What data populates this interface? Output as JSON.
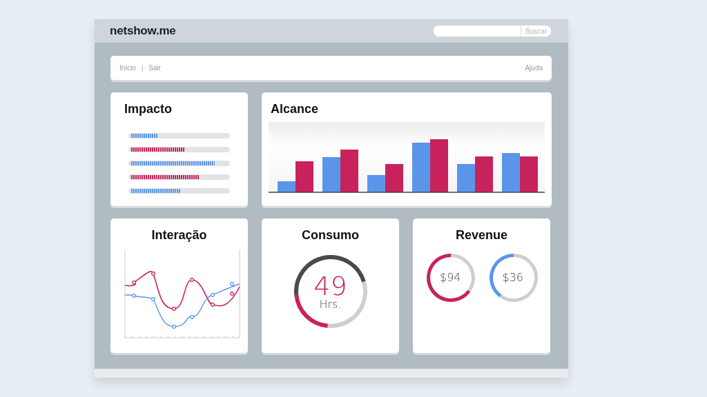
{
  "header": {
    "logo": "netshow.me",
    "search": {
      "button": "Buscar"
    }
  },
  "nav": {
    "links": [
      {
        "label": "Início"
      },
      {
        "label": "Sair"
      }
    ],
    "separator": "|",
    "help": "Ajuda"
  },
  "impacto": {
    "title": "Impacto",
    "bars": [
      {
        "level": 0.28,
        "color": "#5b95ea"
      },
      {
        "level": 0.56,
        "color": "#c8225c"
      },
      {
        "level": 0.87,
        "color": "#5b95ea"
      },
      {
        "level": 0.71,
        "color": "#c8225c"
      },
      {
        "level": 0.52,
        "color": "#5b95ea"
      }
    ]
  },
  "alcance": {
    "title": "Alcance"
  },
  "interacao": {
    "title": "Interação"
  },
  "consumo": {
    "title": "Consumo",
    "value": "49",
    "unit": "Hrs.",
    "segments": [
      {
        "color": "#c8225c"
      },
      {
        "color": "#4a4a4a"
      }
    ]
  },
  "revenue": {
    "title": "Revenue",
    "gauges": [
      {
        "value": "$94",
        "color": "#c8225c"
      },
      {
        "value": "$36",
        "color": "#5b95ea"
      }
    ]
  }
}
